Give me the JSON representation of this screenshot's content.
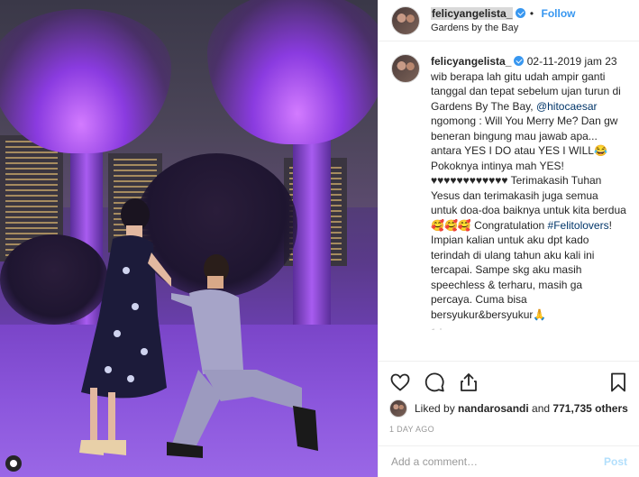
{
  "post": {
    "username": "felicyangelista_",
    "follow_label": "Follow",
    "location": "Gardens by the Bay",
    "caption_user": "felicyangelista_",
    "caption_text_1": " 02-11-2019 jam 23 wib berapa lah gitu udah ampir ganti tanggal dan tepat sebelum ujan turun di Gardens By The Bay, ",
    "mention": "@hitocaesar",
    "caption_text_2": " ngomong : Will You Merry Me? Dan gw beneran bingung mau jawab apa... antara YES I DO atau YES I WILL😂 Pokoknya intinya mah YES! ♥♥♥♥♥♥♥♥♥♥♥♥ Terimakasih Tuhan Yesus dan terimakasih juga semua untuk doa-doa baiknya untuk kita berdua🥰🥰🥰 Congratulation ",
    "hashtag": "#Felitolovers",
    "caption_text_3": "! Impian kalian untuk aku dpt kado terindah di ulang tahun aku kali ini tercapai. Sampe skg aku masih speechless & terharu, masih ga percaya. Cuma bisa bersyukur&bersyukur🙏",
    "ago": "1d",
    "liked_by_prefix": "Liked by ",
    "liked_by_user": "nandarosandi",
    "liked_by_mid": " and ",
    "likes_count": "771,735 others",
    "timestamp": "1 day ago",
    "comment_placeholder": "Add a comment…",
    "post_label": "Post"
  },
  "colors": {
    "accent": "#3897f0",
    "post_disabled": "#b2dffc"
  },
  "icons": [
    "heart-icon",
    "comment-icon",
    "share-icon",
    "bookmark-icon",
    "verified-icon",
    "user-tag-icon"
  ]
}
